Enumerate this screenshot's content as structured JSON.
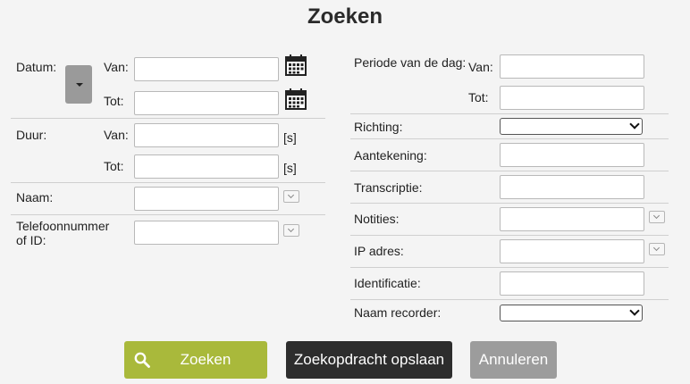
{
  "title": "Zoeken",
  "left": {
    "datum_label": "Datum:",
    "van_label": "Van:",
    "tot_label": "Tot:",
    "duur_label": "Duur:",
    "duur_van_label": "Van:",
    "duur_tot_label": "Tot:",
    "unit_seconds": "[s]",
    "naam_label": "Naam:",
    "telefoon_label": "Telefoonnummer of ID:"
  },
  "right": {
    "periode_label": "Periode van de dag:",
    "periode_van_label": "Van:",
    "periode_tot_label": "Tot:",
    "richting_label": "Richting:",
    "aantekening_label": "Aantekening:",
    "transcriptie_label": "Transcriptie:",
    "notities_label": "Notities:",
    "ip_label": "IP adres:",
    "identificatie_label": "Identificatie:",
    "recorder_label": "Naam recorder:"
  },
  "buttons": {
    "search": "Zoeken",
    "save": "Zoekopdracht opslaan",
    "cancel": "Annuleren"
  },
  "colors": {
    "search_button": "#a9b93b",
    "save_button": "#2d2d2d",
    "cancel_button": "#9c9c9c"
  },
  "icons": {
    "calendar": "calendar-icon",
    "search": "search-icon",
    "chevron": "chevron-down-icon"
  }
}
